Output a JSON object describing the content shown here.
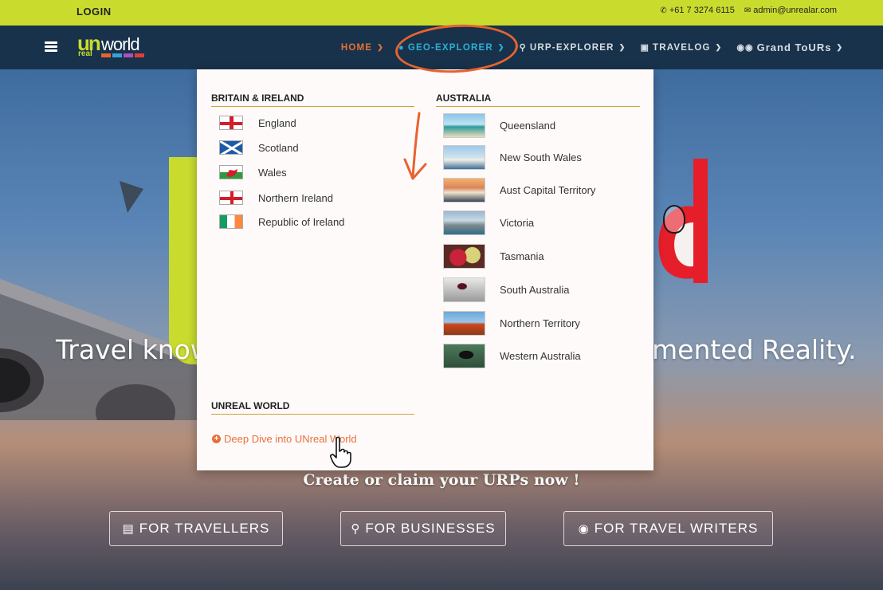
{
  "topbar": {
    "login": "LOGIN",
    "phone": "+61 7 3274 6115",
    "email": "admin@unrealar.com"
  },
  "nav": {
    "logo": {
      "un": "un",
      "world": "world",
      "real": "real"
    },
    "items": [
      {
        "label": "HOME",
        "icon": "",
        "chevron": "chevron-down-icon"
      },
      {
        "label": "GEO-EXPLORER",
        "icon": "globe-icon",
        "chevron": "chevron-down-icon"
      },
      {
        "label": "URP-EXPLORER",
        "icon": "map-marker-icon",
        "chevron": "chevron-down-icon"
      },
      {
        "label": "TRAVELOG",
        "icon": "id-badge-icon",
        "chevron": "chevron-down-icon"
      },
      {
        "label": "Grand ToURs",
        "icon": "motorcycle-icon",
        "chevron": "chevron-down-icon"
      }
    ]
  },
  "dropdown": {
    "britain": {
      "heading": "BRITAIN & IRELAND",
      "items": [
        "England",
        "Scotland",
        "Wales",
        "Northern Ireland",
        "Republic of Ireland"
      ]
    },
    "australia": {
      "heading": "AUSTRALIA",
      "items": [
        "Queensland",
        "New South Wales",
        "Aust Capital Territory",
        "Victoria",
        "Tasmania",
        "South Australia",
        "Northern Territory",
        "Western Australia"
      ]
    },
    "unreal": {
      "heading": "UNREAL WORLD",
      "link": "Deep Dive into UNreal World"
    }
  },
  "hero": {
    "text_left": "Travel know",
    "text_right": "mented Reality.",
    "cta_title": "Create or claim your URPs now !",
    "buttons": [
      "FOR TRAVELLERS",
      "FOR BUSINESSES",
      "FOR TRAVEL WRITERS"
    ]
  },
  "colors": {
    "accent_lime": "#c9dc2e",
    "nav_bg": "#17324a",
    "home_orange": "#e8703a",
    "geo_blue": "#2bb0d6",
    "annotation_orange": "#e7632f"
  }
}
